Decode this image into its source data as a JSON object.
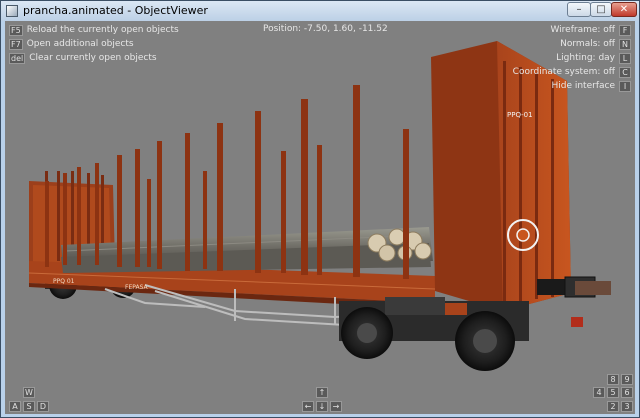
{
  "window": {
    "title": "prancha.animated - ObjectViewer",
    "minimize_glyph": "–",
    "maximize_glyph": "□",
    "close_glyph": "✕"
  },
  "hud": {
    "position": "Position: -7.50, 1.60, -11.52",
    "left_commands": [
      {
        "key": "F5",
        "label": "Reload the currently open objects"
      },
      {
        "key": "F7",
        "label": "Open additional objects"
      },
      {
        "key": "del",
        "label": "Clear currently open objects"
      }
    ],
    "right_commands": [
      {
        "key": "F",
        "label": "Wireframe: off"
      },
      {
        "key": "N",
        "label": "Normals: off"
      },
      {
        "key": "L",
        "label": "Lighting: day"
      },
      {
        "key": "C",
        "label": "Coordinate system: off"
      },
      {
        "key": "I",
        "label": "Hide interface"
      }
    ],
    "movement_keys": {
      "up": "W",
      "left": "A",
      "down": "S",
      "right": "D"
    },
    "arrow_keys": {
      "up": "↑",
      "left": "←",
      "down": "↓",
      "right": "→"
    },
    "numpad_keys": [
      "8",
      "9",
      "4",
      "5",
      "6",
      "2",
      "3"
    ]
  },
  "scene": {
    "car_markings": {
      "left_id": "PPQ 01",
      "brand": "FEPASA",
      "end_id": "PPQ-01"
    }
  }
}
